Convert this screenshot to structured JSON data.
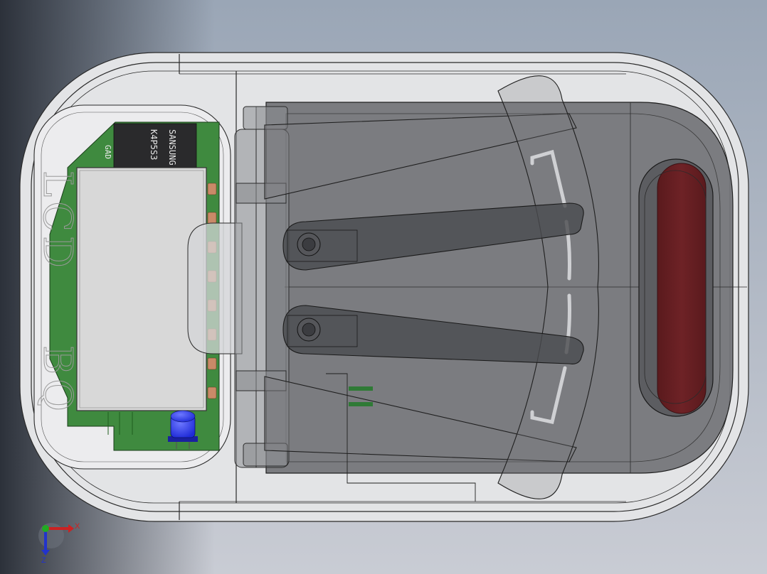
{
  "viewport": {
    "background_top": "#9aa6b6",
    "background_bottom": "#c9ccd4",
    "background_left_shadow": "#2c313a"
  },
  "model": {
    "name": "battery charger housing",
    "body_color": "#e3e4e6",
    "tray_color": "#6f7074",
    "edge_color": "#2a2a2a",
    "engraving": {
      "top": "LCD",
      "bottom": "BQ"
    },
    "pcb": {
      "color": "#3f8a3f",
      "chip_marking": [
        "SANSUNG",
        "K4P5S3",
        "GAD"
      ],
      "lcd_module_color": "#d8d8d8",
      "pad_color": "#c98a68",
      "led_color": "#1f2bd8"
    },
    "contacts": {
      "count": 2,
      "color": "#4a4b4f"
    },
    "indicator": {
      "color": "#6e2226"
    }
  },
  "triad": {
    "x_label": "X",
    "z_label": "Z",
    "x_color": "#cc2222",
    "y_color": "#22aa22",
    "z_color": "#2233cc"
  }
}
